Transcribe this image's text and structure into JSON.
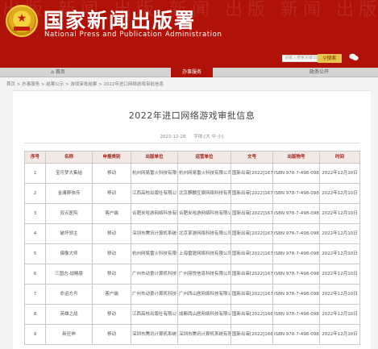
{
  "header": {
    "title_cn": "国家新闻出版署",
    "title_en": "National Press and Publication Administration",
    "bg_text": "出版 新闻 出版 新闻 出版 新闻 出版",
    "search_placeholder": "请输入搜索关键词",
    "search_button": "搜索"
  },
  "nav": {
    "items": [
      "首页",
      "办事服务",
      "政务公开"
    ],
    "active_index": 1
  },
  "breadcrumb": "首页 > 办事服务 > 结果公示 > 游戏审批结果 > 2022年进口网络游戏审批信息",
  "article": {
    "title": "2022年进口网络游戏审批信息",
    "date": "2022-12-28",
    "font_size_label": "字体:[大 中 小]"
  },
  "table": {
    "headers": [
      "序号",
      "名称",
      "申报类别",
      "出版单位",
      "运营单位",
      "文号",
      "出版物号",
      "时间"
    ],
    "rows": [
      {
        "no": "1",
        "name": "宝可梦大集结",
        "type": "移动",
        "publisher": "杭州网易雷火科技有限公司",
        "operator": "杭州网易雷火科技有限公司",
        "doc": "国新出审[2022]1676号",
        "isbn": "ISBN 978-7-498-09846-7",
        "date": "2022年12月10日"
      },
      {
        "no": "2",
        "name": "金庸群侠传",
        "type": "移动",
        "publisher": "江西高校出版社有限公司",
        "operator": "北京麒麟互娱网络科技有限公司",
        "doc": "国新出审[2022]1675号",
        "isbn": "ISBN 978-7-498-09847-4",
        "date": "2022年12月10日"
      },
      {
        "no": "3",
        "name": "双点医院",
        "type": "客户端",
        "publisher": "合肥米哈游网络科技有限公司",
        "operator": "合肥米哈游网络科技有限公司",
        "doc": "国新出审[2022]1674号",
        "isbn": "ISBN 978-7-498-09848-1",
        "date": "2022年12月10日"
      },
      {
        "no": "4",
        "name": "破坏领主",
        "type": "移动",
        "publisher": "深圳市腾讯计算机系统有限公司",
        "operator": "北京掌游网络科技有限公司",
        "doc": "国新出审[2022]1673号",
        "isbn": "ISBN 978-7-498-09849-8",
        "date": "2022年12月10日"
      },
      {
        "no": "5",
        "name": "偶像大师",
        "type": "移动",
        "publisher": "杭州网易雷火科技有限公司",
        "operator": "上海雷霆网络科技有限公司",
        "doc": "国新出审[2022]1672号",
        "isbn": "ISBN 978-7-498-09850-4",
        "date": "2022年12月10日"
      },
      {
        "no": "6",
        "name": "三国志·战略版",
        "type": "移动",
        "publisher": "广州市动景计算机科技有限公司",
        "operator": "广州简悦信息科技有限公司",
        "doc": "国新出审[2022]1671号",
        "isbn": "ISBN 978-7-498-09851-1",
        "date": "2022年12月10日"
      },
      {
        "no": "7",
        "name": "命运方舟",
        "type": "客户端",
        "publisher": "广州市动景计算机科技有限公司",
        "operator": "广州西山居网络科技有限公司",
        "doc": "国新出审[2022]1670号",
        "isbn": "ISBN 978-7-498-09852-8",
        "date": "2022年12月10日"
      },
      {
        "no": "8",
        "name": "英雄之战",
        "type": "移动",
        "publisher": "江西高校出版社有限公司",
        "operator": "成都西山居网络科技有限公司",
        "doc": "国新出审[2022]1669号",
        "isbn": "ISBN 978-7-498-09853-5",
        "date": "2022年12月10日"
      },
      {
        "no": "9",
        "name": "新狂神",
        "type": "移动",
        "publisher": "深圳市腾讯计算机系统有限公司",
        "operator": "深圳市腾讯计算机系统有限公司",
        "doc": "国新出审[2022]1668号",
        "isbn": "ISBN 978-7-498-09854-2",
        "date": "2022年12月10日"
      }
    ]
  },
  "colors": {
    "brand_red": "#b01208",
    "gold": "#e8c44a",
    "header_text": "#9b1e10"
  }
}
